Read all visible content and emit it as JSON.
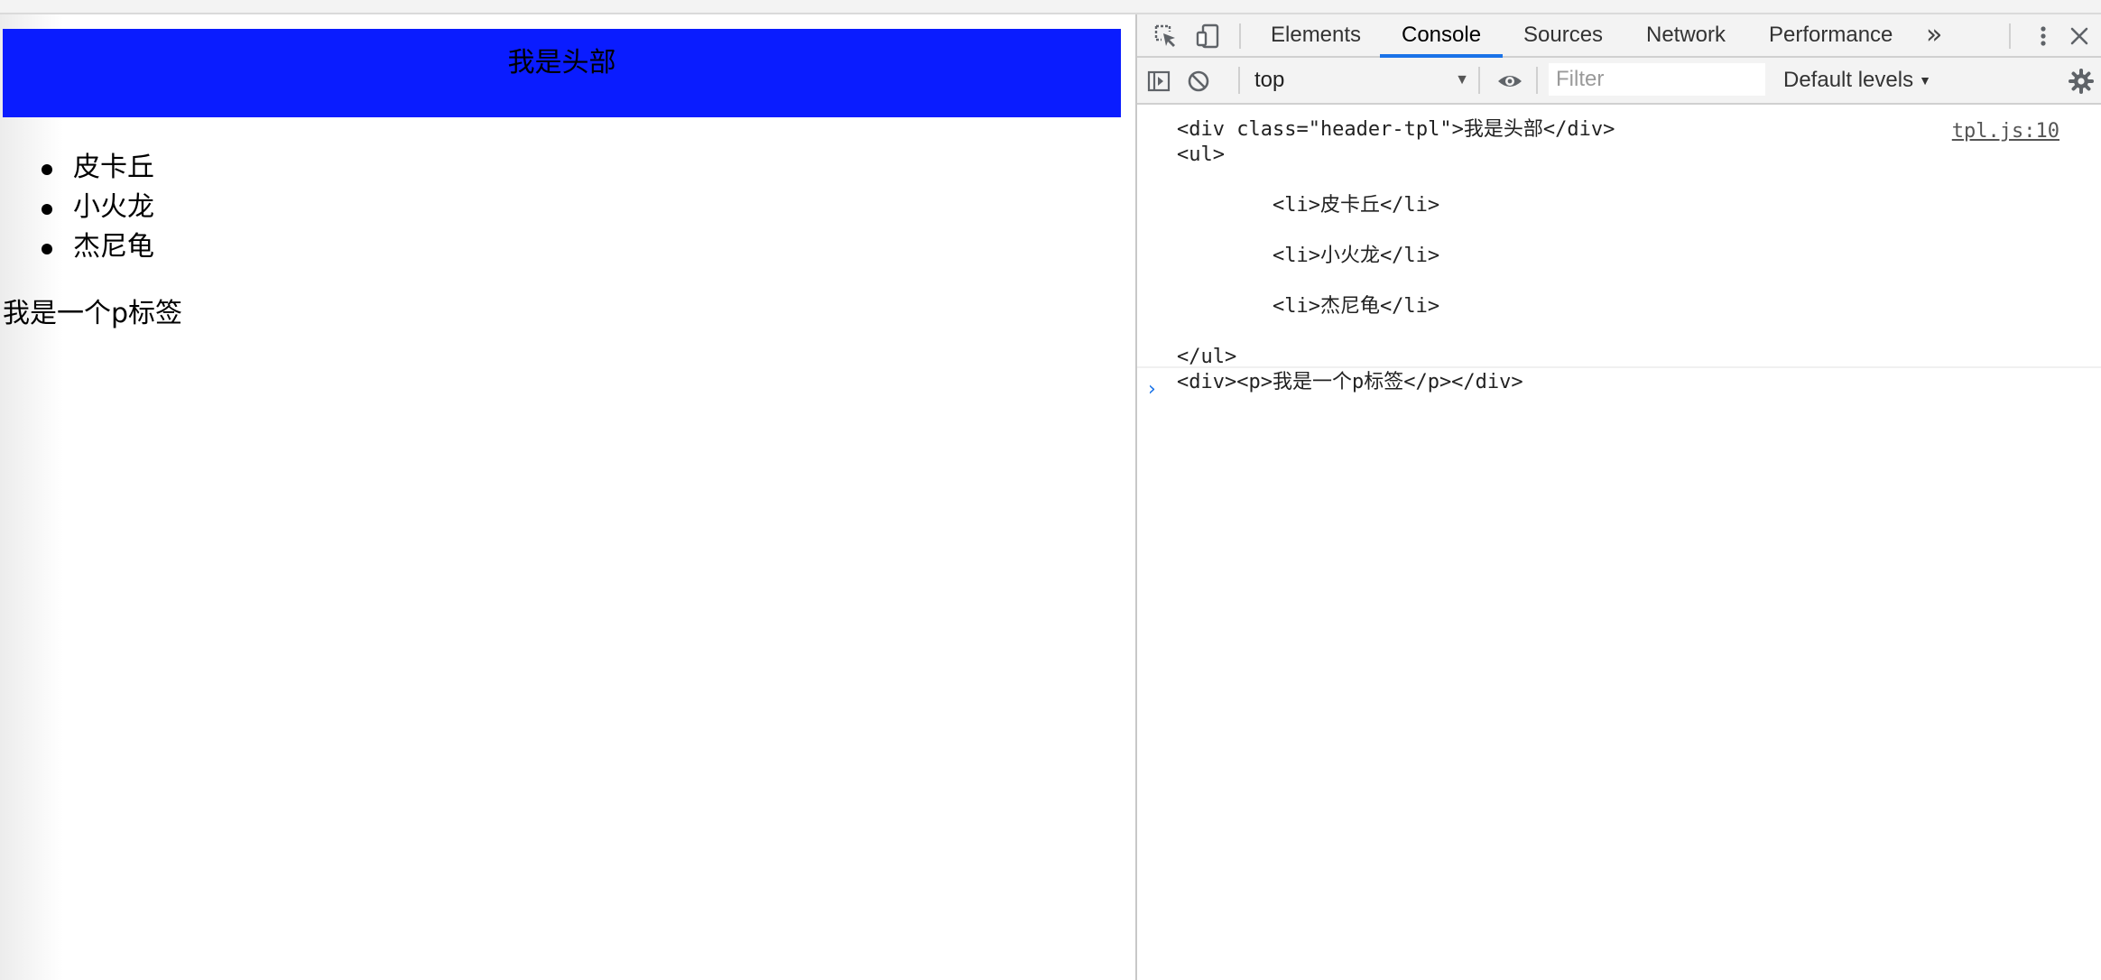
{
  "page": {
    "header_text": "我是头部",
    "list_items": [
      "皮卡丘",
      "小火龙",
      "杰尼龟"
    ],
    "paragraph": "我是一个p标签",
    "header_color": "#0a1cff"
  },
  "devtools": {
    "tabs": [
      "Elements",
      "Console",
      "Sources",
      "Network",
      "Performance"
    ],
    "active_tab": "Console",
    "more_tabs": "»",
    "context": "top",
    "filter_placeholder": "Filter",
    "levels": "Default levels",
    "accent_color": "#1a73e8",
    "icons": [
      "inspect-icon",
      "device-toolbar-icon",
      "kebab-menu-icon",
      "close-icon",
      "sidebar-toggle-icon",
      "clear-console-icon",
      "eye-icon",
      "settings-gear-icon"
    ]
  },
  "console": {
    "source": "tpl.js:10",
    "lines": [
      "<div class=\"header-tpl\">我是头部</div>",
      "<ul>",
      "",
      "        <li>皮卡丘</li>",
      "",
      "        <li>小火龙</li>",
      "",
      "        <li>杰尼龟</li>",
      "",
      "</ul>",
      "<div><p>我是一个p标签</p></div>"
    ],
    "prompt": "›"
  }
}
